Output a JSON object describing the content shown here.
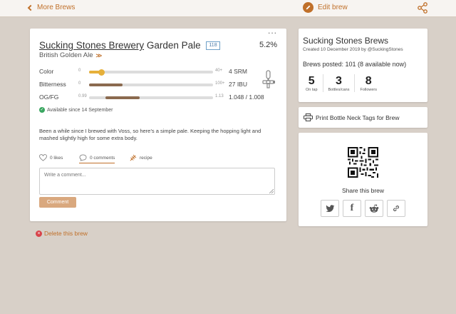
{
  "nav": {
    "back_label": "More Brews",
    "edit_label": "Edit brew"
  },
  "brew": {
    "brewery": "Sucking Stones Brewery",
    "name": "Garden Pale",
    "badge": "118",
    "abv": "5.2%",
    "style": "British Golden Ale",
    "stats": [
      {
        "label": "Color",
        "min": "0",
        "max": "40+",
        "value": "4 SRM",
        "level": 0.1,
        "color": "#e6b03a"
      },
      {
        "label": "Bitterness",
        "min": "0",
        "max": "100+",
        "value": "27 IBU",
        "level": 0.27,
        "color": "#8b6a4f"
      },
      {
        "label": "OG/FG",
        "min": "0.99",
        "max": "1.13",
        "value": "1.048 / 1.008",
        "level_from": 0.13,
        "level_to": 0.41,
        "color": "#8b6a4f"
      }
    ],
    "availability": "Available since 14 September",
    "description": "Been a while since I brewed with Voss, so here’s a simple pale. Keeping the hopping light and mashed slightly high for some extra body.",
    "likes_label": "0 likes",
    "comments_label": "0 comments",
    "recipe_label": "recipe",
    "comment_placeholder": "Write a comment...",
    "comment_button": "Comment",
    "delete_label": "Delete this brew"
  },
  "brewer": {
    "name": "Sucking Stones Brews",
    "subtitle": "Created 10 December 2019 by @SuckingStones",
    "posted": "Brews posted: 101 (8 available now)",
    "on_tap": {
      "value": "5",
      "label": "On tap"
    },
    "bottles": {
      "value": "3",
      "label": "Bottles/cans"
    },
    "followers": {
      "value": "8",
      "label": "Followers"
    }
  },
  "print_label": "Print Bottle Neck Tags for Brew",
  "share_label": "Share this brew",
  "colors": {
    "accent": "#c0702a",
    "background": "#d8d0c8",
    "color_bar": "#e6b03a",
    "malt_bar": "#8b6a4f"
  }
}
